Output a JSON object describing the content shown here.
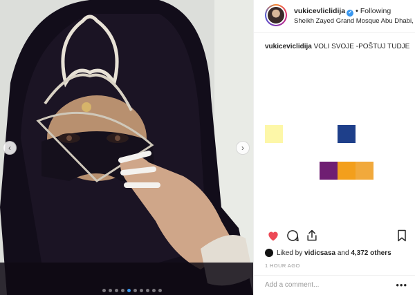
{
  "header": {
    "username": "vukicevliclidija",
    "follow_label": "Following",
    "location": "Sheikh Zayed Grand Mosque Abu Dhabi, U..."
  },
  "caption": {
    "username": "vukiceviclidija",
    "text": "VOLI SVOJE -POŠTUJ TUDJE"
  },
  "swatches": {
    "colors": [
      "#fdf7a8",
      "#1e3f8a",
      "#6f1e72",
      "#f39f1c",
      "#f1a93c"
    ]
  },
  "likes": {
    "prefix": "Liked by",
    "user": "vidicsasa",
    "middle": "and",
    "count": "4,372 others"
  },
  "time": "1 HOUR AGO",
  "comment": {
    "placeholder": "Add a comment..."
  },
  "carousel": {
    "dot_count": 10,
    "active_index": 4
  },
  "colors": {
    "like_red": "#ed4956",
    "verified_blue": "#3897f0"
  }
}
